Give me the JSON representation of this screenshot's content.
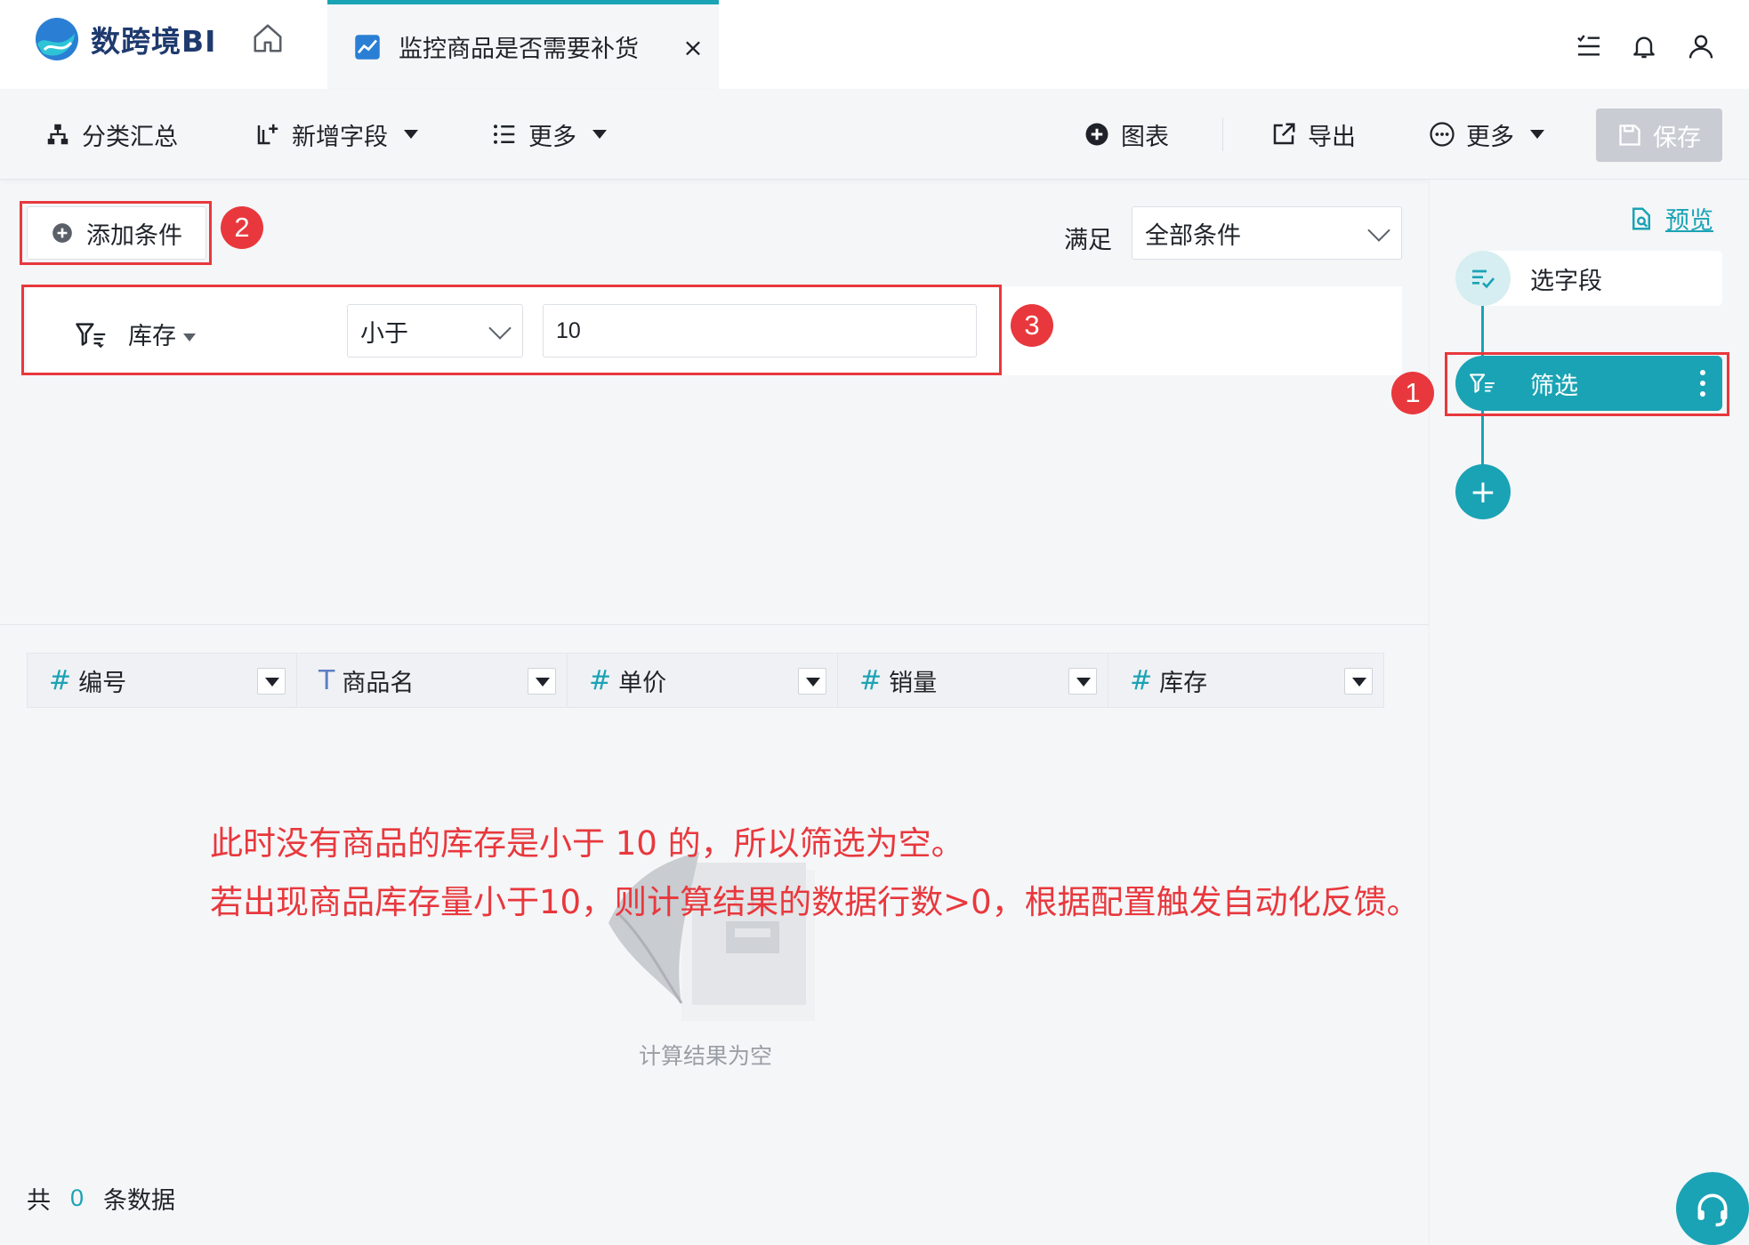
{
  "app": {
    "logo_text": "数跨境BI",
    "tab_title": "监控商品是否需要补货",
    "tab_close": "×"
  },
  "toolbar": {
    "group_summary": "分类汇总",
    "add_field": "新增字段",
    "more_left": "更多",
    "chart": "图表",
    "export": "导出",
    "more_right": "更多",
    "save": "保存"
  },
  "filter": {
    "add_condition": "添加条件",
    "satisfy_label": "满足",
    "satisfy_value": "全部条件",
    "condition": {
      "field": "库存",
      "operator": "小于",
      "value": "10"
    }
  },
  "table": {
    "columns": [
      {
        "type_icon": "#",
        "name": "编号"
      },
      {
        "type_icon": "T",
        "name": "商品名"
      },
      {
        "type_icon": "#",
        "name": "单价"
      },
      {
        "type_icon": "#",
        "name": "销量"
      },
      {
        "type_icon": "#",
        "name": "库存"
      }
    ],
    "empty_text": "计算结果为空"
  },
  "annotation": {
    "line1": "此时没有商品的库存是小于 10 的，所以筛选为空。",
    "line2": "若出现商品库存量小于10，则计算结果的数据行数>0，根据配置触发自动化反馈。"
  },
  "badges": {
    "b1": "1",
    "b2": "2",
    "b3": "3"
  },
  "footer": {
    "prefix": "共",
    "count": "0",
    "suffix": "条数据"
  },
  "steps": {
    "preview": "预览",
    "select_fields": "选字段",
    "filter": "筛选",
    "add": "+"
  },
  "colors": {
    "accent": "#1aa3b5",
    "highlight": "#e8383d",
    "save_disabled": "#c9ccd3"
  }
}
